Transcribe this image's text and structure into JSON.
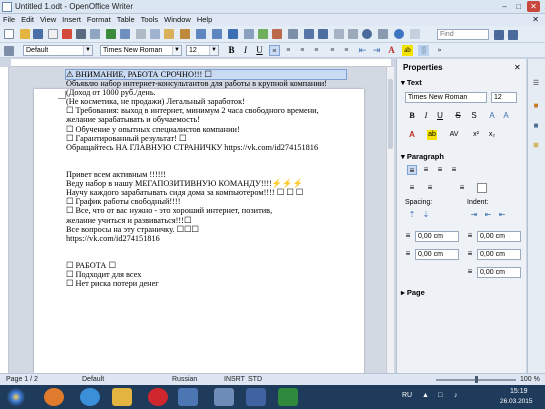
{
  "window": {
    "title": "Untitled 1.odt - OpenOffice Writer"
  },
  "menu": [
    "File",
    "Edit",
    "View",
    "Insert",
    "Format",
    "Table",
    "Tools",
    "Window",
    "Help"
  ],
  "toolbar": {
    "find_placeholder": "Find"
  },
  "formatting": {
    "style": "Default",
    "font": "Times New Roman",
    "size": "12"
  },
  "document": {
    "lines": [
      "⚠ ВНИМАНИЕ, РАБОТА СРОЧНО!!! ☐",
      "Объявлю набор интернет-консультантов для работы в крупной компании!",
      "(Доход от 1000 руб./день.",
      "(Не косметика, не продажи) Легальный заработок!",
      "☐ Требования: выход в интернет, минимум 2 часа свободного времени,",
      " желание зарабатывать и обучаемость!",
      "☐ Обучение у опытных специалистов компании!",
      "☐ Гарантированный результат! ☐",
      "Обращайтесь НА ГЛАВНУЮ СТРАНИЧКУ https://vk.com/id274151816",
      "",
      "",
      "Привет всем активным !!!!!!",
      "Веду набор в нашу МЕГАПОЗИТИВНУЮ КОМАНДУ!!!!⚡⚡⚡",
      "Научу каждого зарабатывать сидя дома за компьютером!!!! ☐ ☐ ☐",
      "☐ График работы свободный!!!!",
      "☐ Все, что от вас нужно - это хороший интернет, позитив,",
      "желание учиться и развиваться!!!☐",
      "Все вопросы на эту страничку. ☐☐☐",
      "https://vk.com/id274151816",
      "",
      "",
      "☐ РАБОТА ☐",
      "☐ Подходит для всех",
      "☐ Нет риска потери денег"
    ]
  },
  "sidebar": {
    "title": "Properties",
    "text_section": "Text",
    "font": "Times New Roman",
    "size": "12",
    "paragraph_section": "Paragraph",
    "spacing_label": "Spacing:",
    "indent_label": "Indent:",
    "values": [
      "0,00 cm",
      "0,00 cm",
      "0,00 cm",
      "0,00 cm",
      "0,00 cm"
    ],
    "page_section": "Page"
  },
  "status": {
    "page": "Page 1 / 2",
    "style": "Default",
    "language": "Russian",
    "insert": "INSRT",
    "selection": "STD",
    "zoom": "100 %"
  },
  "taskbar": {
    "lang": "RU",
    "time": "15:19",
    "date": "26.03.2015"
  },
  "colors": {
    "accent": "#1f3b5b",
    "highlight": "#c9daf2"
  }
}
